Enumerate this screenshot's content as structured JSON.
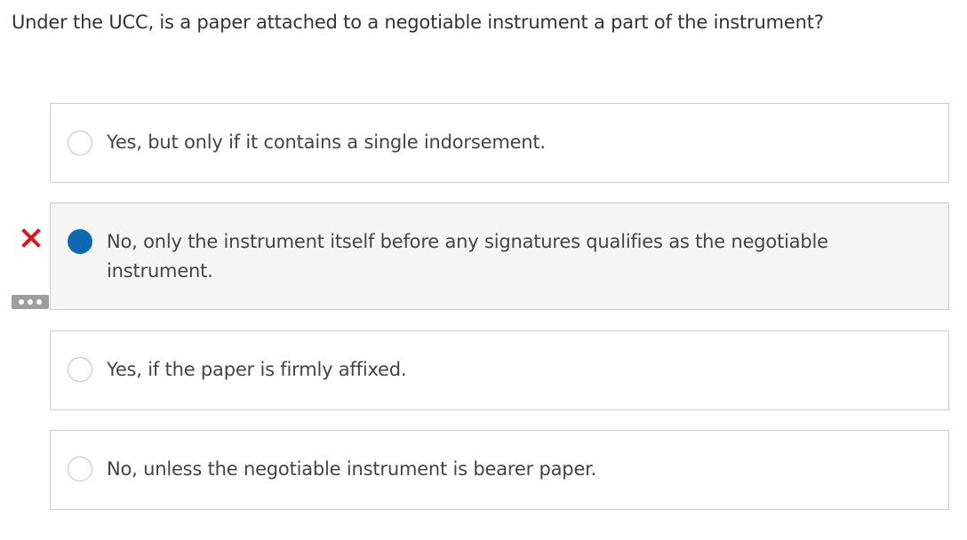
{
  "question": {
    "text": "Under the UCC, is a paper attached to a negotiable instrument a part of the instrument?"
  },
  "options": [
    {
      "label": "Yes, but only if it contains a single indorsement.",
      "selected": false
    },
    {
      "label": "No, only the instrument itself before any signatures qualifies as the negotiable instrument.",
      "selected": true,
      "result": "incorrect"
    },
    {
      "label": "Yes, if the paper is firmly affixed.",
      "selected": false
    },
    {
      "label": "No, unless the negotiable instrument is bearer paper.",
      "selected": false
    }
  ],
  "icons": {
    "incorrect": "x-mark-icon",
    "more": "more-options-icon"
  },
  "colors": {
    "selected_radio": "#0e6ab0",
    "incorrect_mark": "#e0161c",
    "selected_background": "#f5f5f5",
    "border": "#cccccc"
  }
}
